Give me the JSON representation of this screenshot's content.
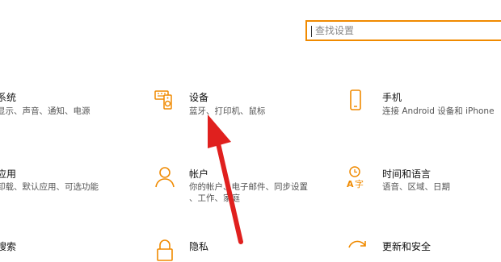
{
  "search": {
    "placeholder": "查找设置",
    "value": ""
  },
  "tiles": [
    {
      "title": "系统",
      "subtitle": "显示、声音、通知、电源",
      "icon": "laptop-icon"
    },
    {
      "title": "设备",
      "subtitle": "蓝牙、打印机、鼠标",
      "icon": "keyboard-speaker-icon"
    },
    {
      "title": "手机",
      "subtitle": "连接 Android 设备和 iPhone",
      "icon": "phone-icon"
    },
    {
      "title": "应用",
      "subtitle": "卸载、默认应用、可选功能",
      "icon": "apps-icon"
    },
    {
      "title": "帐户",
      "subtitle": "你的帐户、电子邮件、同步设置",
      "subtitle2": "、工作、家庭",
      "icon": "person-icon"
    },
    {
      "title": "时间和语言",
      "subtitle": "语音、区域、日期",
      "icon": "time-language-icon"
    },
    {
      "title": "搜索",
      "icon": "search-icon"
    },
    {
      "title": "隐私",
      "icon": "lock-icon"
    },
    {
      "title": "更新和安全",
      "icon": "update-icon"
    }
  ],
  "colors": {
    "accent": "#f08a00",
    "arrow": "#e0201e"
  }
}
